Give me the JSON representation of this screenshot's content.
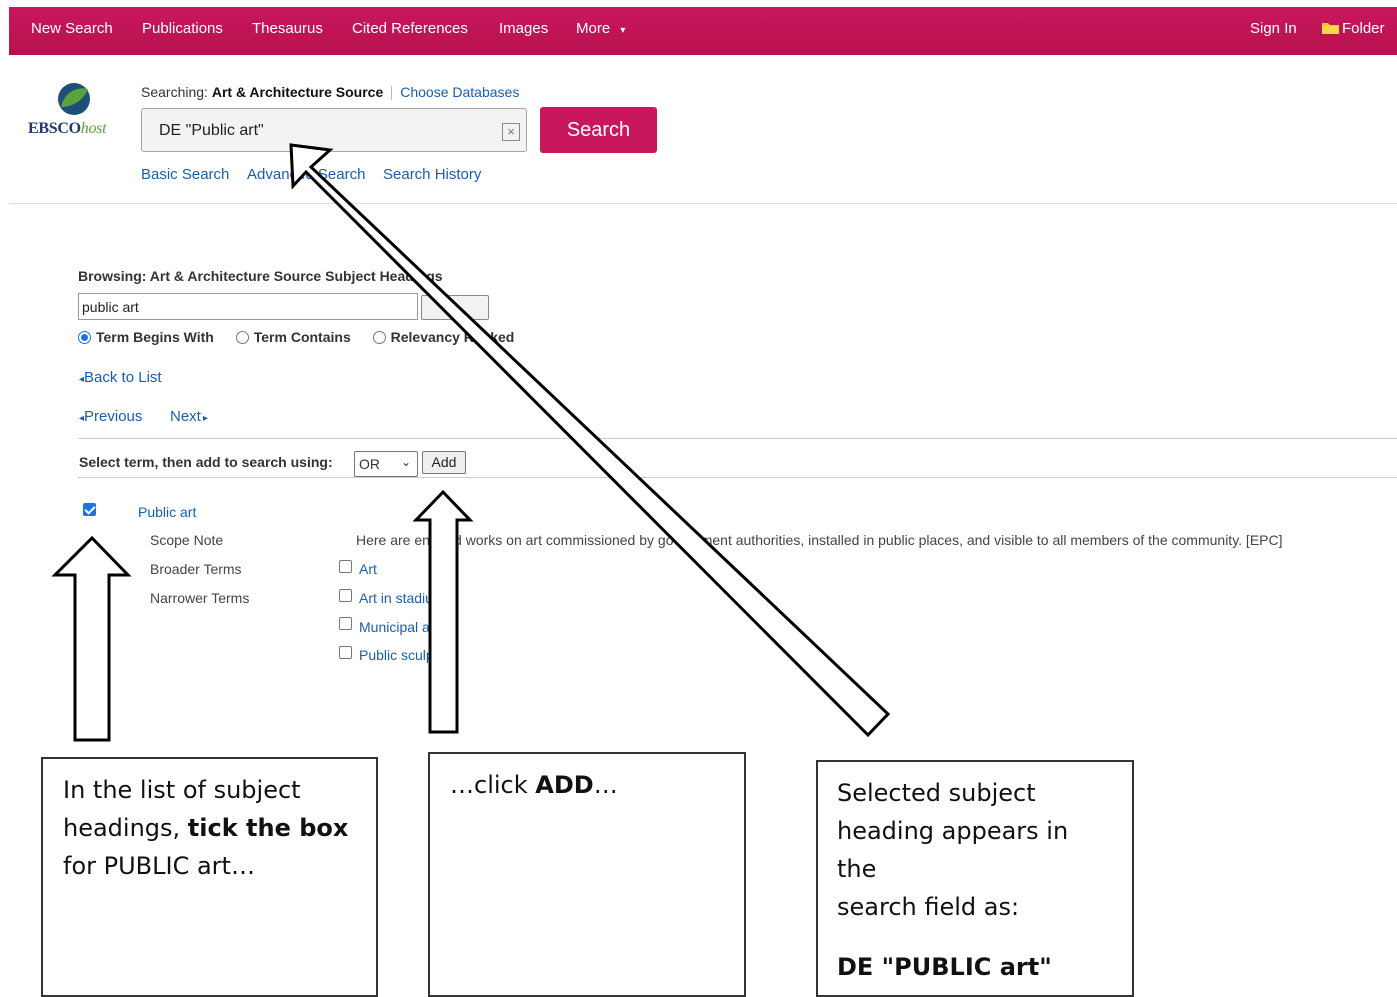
{
  "topnav": {
    "left_items": [
      "New Search",
      "Publications",
      "Thesaurus",
      "Cited References",
      "Images",
      "More"
    ],
    "more_caret": "▾",
    "sign_in": "Sign In",
    "folder": "Folder"
  },
  "logo": {
    "brand": "EBSCO",
    "brand_suffix": "host"
  },
  "searching": {
    "label": "Searching:",
    "database": "Art & Architecture Source",
    "choose_db": "Choose Databases"
  },
  "search": {
    "query": "DE \"Public art\"",
    "clear_glyph": "×",
    "button": "Search"
  },
  "sublinks": [
    "Basic Search",
    "Advanced Search",
    "Search History"
  ],
  "browse": {
    "heading": "Browsing: Art & Architecture Source Subject Headings",
    "input_value": "public art",
    "options": [
      {
        "label": "Term Begins With",
        "checked": true
      },
      {
        "label": "Term Contains",
        "checked": false
      },
      {
        "label": "Relevancy Ranked",
        "checked": false
      }
    ],
    "back_to_list": "Back to List",
    "previous": "Previous",
    "next": "Next"
  },
  "select_row": {
    "label": "Select term, then add to search using:",
    "operator": "OR",
    "add_button": "Add"
  },
  "term": {
    "name": "Public art",
    "checked": true,
    "scope_label": "Scope Note",
    "scope_text": "Here are entered works on art commissioned by government authorities, installed in public places, and visible to all members of the community. [EPC]",
    "broader_label": "Broader Terms",
    "broader": [
      "Art"
    ],
    "narrower_label": "Narrower Terms",
    "narrower": [
      "Art in stadiums",
      "Municipal art",
      "Public sculpture"
    ]
  },
  "callouts": {
    "c1_line1": "In the list of subject",
    "c1_line2a": "headings, ",
    "c1_line2b": "tick the box",
    "c1_line3": "for PUBLIC art…",
    "c2_pre": "…click ",
    "c2_bold": "ADD",
    "c2_post": "…",
    "c3_line1": "Selected subject",
    "c3_line2": "heading appears in the",
    "c3_line3": "search field as:",
    "c3_line4": "DE \"PUBLIC art\""
  },
  "colors": {
    "brand_magenta": "#c8175c",
    "link_blue": "#1a5ea8"
  }
}
